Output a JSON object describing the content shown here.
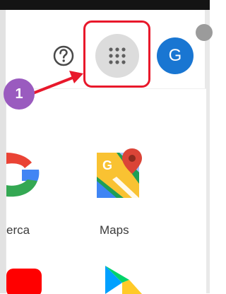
{
  "header": {
    "help_icon": "help-circle-icon",
    "apps_icon": "grid-dots-icon",
    "avatar_letter": "G"
  },
  "annotation": {
    "step_number": "1",
    "highlight_color": "#e8182b",
    "badge_color": "#9a5bbf"
  },
  "apps": [
    {
      "label": "erca",
      "icon": "google-g-icon"
    },
    {
      "label": "Maps",
      "icon": "google-maps-icon"
    },
    {
      "label": "",
      "icon": "youtube-icon"
    },
    {
      "label": "",
      "icon": "play-store-icon"
    }
  ],
  "colors": {
    "avatar": "#1976d2",
    "apps_button": "#dcdcdc"
  }
}
